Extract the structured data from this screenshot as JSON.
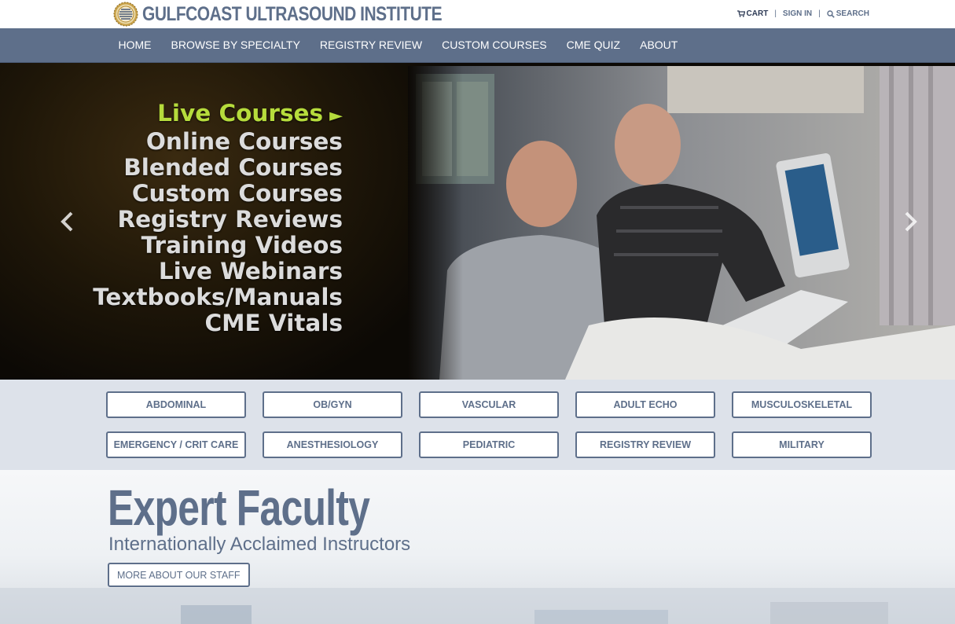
{
  "header": {
    "logo_text": "GULFCOAST ULTRASOUND INSTITUTE",
    "utility": {
      "cart": "CART",
      "sign_in": "SIGN IN",
      "search": "SEARCH",
      "separator": "|"
    }
  },
  "nav": {
    "items": [
      {
        "label": "HOME"
      },
      {
        "label": "BROWSE BY SPECIALTY"
      },
      {
        "label": "REGISTRY REVIEW"
      },
      {
        "label": "CUSTOM COURSES"
      },
      {
        "label": "CME QUIZ"
      },
      {
        "label": "ABOUT"
      }
    ]
  },
  "hero": {
    "lines": [
      "Live Courses",
      "Online Courses",
      "Blended Courses",
      "Custom Courses",
      "Registry Reviews",
      "Training Videos",
      "Live Webinars",
      "Textbooks/Manuals",
      "CME Vitals"
    ],
    "arrow": "►",
    "prev_icon": "chevron-left-icon",
    "next_icon": "chevron-right-icon"
  },
  "specialties": {
    "row1": [
      "ABDOMINAL",
      "OB/GYN",
      "VASCULAR",
      "ADULT ECHO",
      "MUSCULOSKELETAL"
    ],
    "row2": [
      "EMERGENCY / CRIT CARE",
      "ANESTHESIOLOGY",
      "PEDIATRIC",
      "REGISTRY REVIEW",
      "MILITARY"
    ]
  },
  "feature": {
    "title": "Expert Faculty",
    "subtitle": "Internationally Acclaimed Instructors",
    "button": "MORE ABOUT OUR STAFF"
  },
  "colors": {
    "brand": "#5e6f8a",
    "nav_bg": "#5e6f8a",
    "specialty_band": "#dde2ea",
    "hero_highlight": "#b6dc3c",
    "hero_text": "#dcdcdc"
  }
}
